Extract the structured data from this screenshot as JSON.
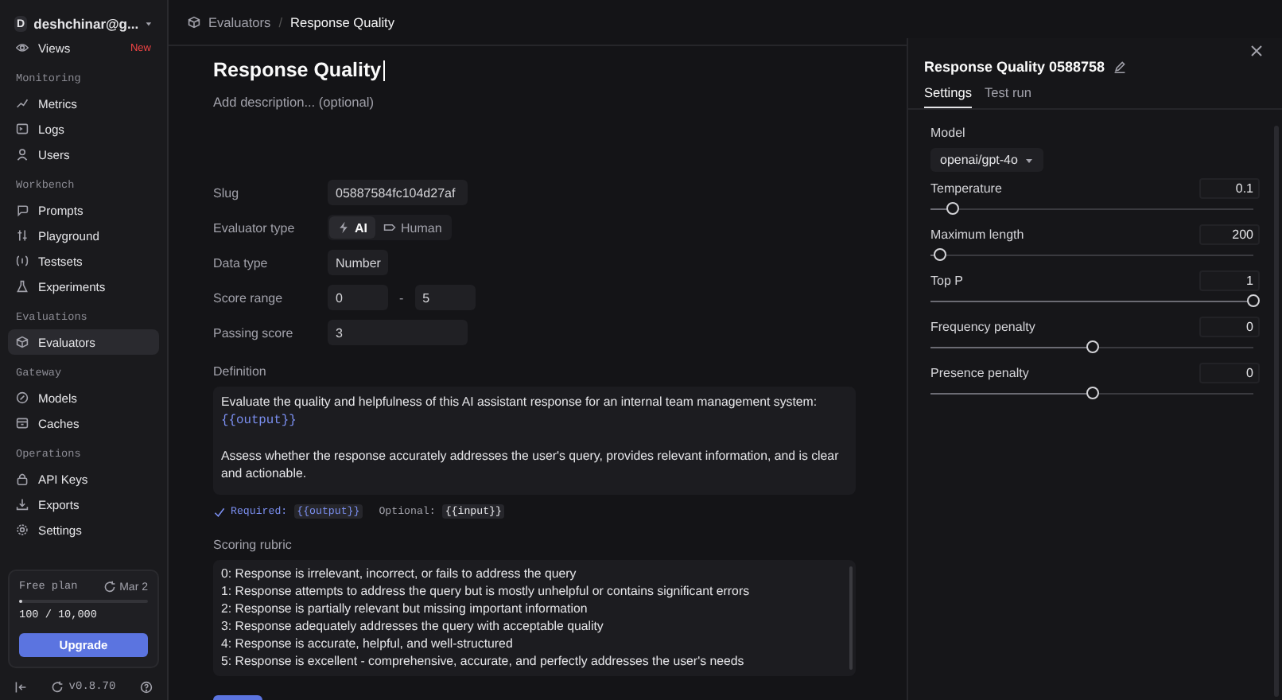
{
  "sidebar": {
    "account": {
      "initial": "D",
      "name": "deshchinar@g..."
    },
    "views": {
      "label": "Views",
      "badge": "New",
      "selected": false
    },
    "sections": [
      {
        "title": "Monitoring",
        "items": [
          {
            "label": "Metrics",
            "selected": false
          },
          {
            "label": "Logs",
            "selected": false
          },
          {
            "label": "Users",
            "selected": false
          }
        ]
      },
      {
        "title": "Workbench",
        "items": [
          {
            "label": "Prompts",
            "selected": false
          },
          {
            "label": "Playground",
            "selected": false
          },
          {
            "label": "Testsets",
            "selected": false
          },
          {
            "label": "Experiments",
            "selected": false
          }
        ]
      },
      {
        "title": "Evaluations",
        "items": [
          {
            "label": "Evaluators",
            "selected": true
          }
        ]
      },
      {
        "title": "Gateway",
        "items": [
          {
            "label": "Models",
            "selected": false
          },
          {
            "label": "Caches",
            "selected": false
          }
        ]
      },
      {
        "title": "Operations",
        "items": [
          {
            "label": "API Keys",
            "selected": false
          },
          {
            "label": "Exports",
            "selected": false
          },
          {
            "label": "Settings",
            "selected": false
          }
        ]
      }
    ],
    "plan": {
      "name": "Free plan",
      "reset": "Mar 2",
      "level": 0.01,
      "usage": "100 / 10,000",
      "button": "Upgrade"
    },
    "version": "v0.8.70"
  },
  "breadcrumb": [
    "Evaluators",
    "Response Quality"
  ],
  "breadcrumb_separator": "/",
  "form": {
    "title": "Response Quality",
    "description": {
      "placeholder": "Add description... (optional)"
    },
    "slug": {
      "label": "Slug",
      "value": "05887584fc104d27af"
    },
    "evaluator_type": {
      "label": "Evaluator type",
      "options": [
        {
          "label": "AI",
          "selected": true
        },
        {
          "label": "Human",
          "selected": false
        }
      ]
    },
    "data_type": {
      "label": "Data type",
      "value": "Number"
    },
    "score_range": {
      "label": "Score range",
      "min": "0",
      "separator": "-",
      "max": "5"
    },
    "passing_score": {
      "label": "Passing score",
      "value": "3"
    },
    "definition": {
      "label": "Definition",
      "paragraphs": [
        [
          {
            "kind": "text",
            "text": "Evaluate the quality and helpfulness of this AI assistant response for an internal team management system: "
          },
          {
            "kind": "variable",
            "text": "{{output}}"
          }
        ],
        [
          {
            "kind": "text",
            "text": "Assess whether the response accurately addresses the user's query, provides relevant information, and is clear and actionable."
          }
        ]
      ]
    },
    "variables": {
      "required_label": "Required:",
      "required": "{{output}}",
      "optional_label": "Optional:",
      "optional": "{{input}}"
    },
    "rubric": {
      "label": "Scoring rubric",
      "lines": [
        "0: Response is irrelevant, incorrect, or fails to address the query",
        "1: Response attempts to address the query but is mostly unhelpful or contains significant errors",
        "2: Response is partially relevant but missing important information",
        "3: Response adequately addresses the query with acceptable quality",
        "4: Response is accurate, helpful, and well-structured",
        "5: Response is excellent - comprehensive, accurate, and perfectly addresses the user's needs"
      ]
    }
  },
  "drawer": {
    "title": "Response Quality 0588758",
    "tabs": [
      {
        "label": "Settings",
        "selected": true
      },
      {
        "label": "Test run",
        "selected": false
      }
    ],
    "model": {
      "label": "Model",
      "value": "openai/gpt-4o"
    },
    "params": [
      {
        "label": "Temperature",
        "value": "0.1",
        "level": 0.07
      },
      {
        "label": "Maximum length",
        "value": "200",
        "level": 0.03
      },
      {
        "label": "Top P",
        "value": "1",
        "level": 1
      },
      {
        "label": "Frequency penalty",
        "value": "0",
        "level": 0.5
      },
      {
        "label": "Presence penalty",
        "value": "0",
        "level": 0.5
      }
    ]
  }
}
